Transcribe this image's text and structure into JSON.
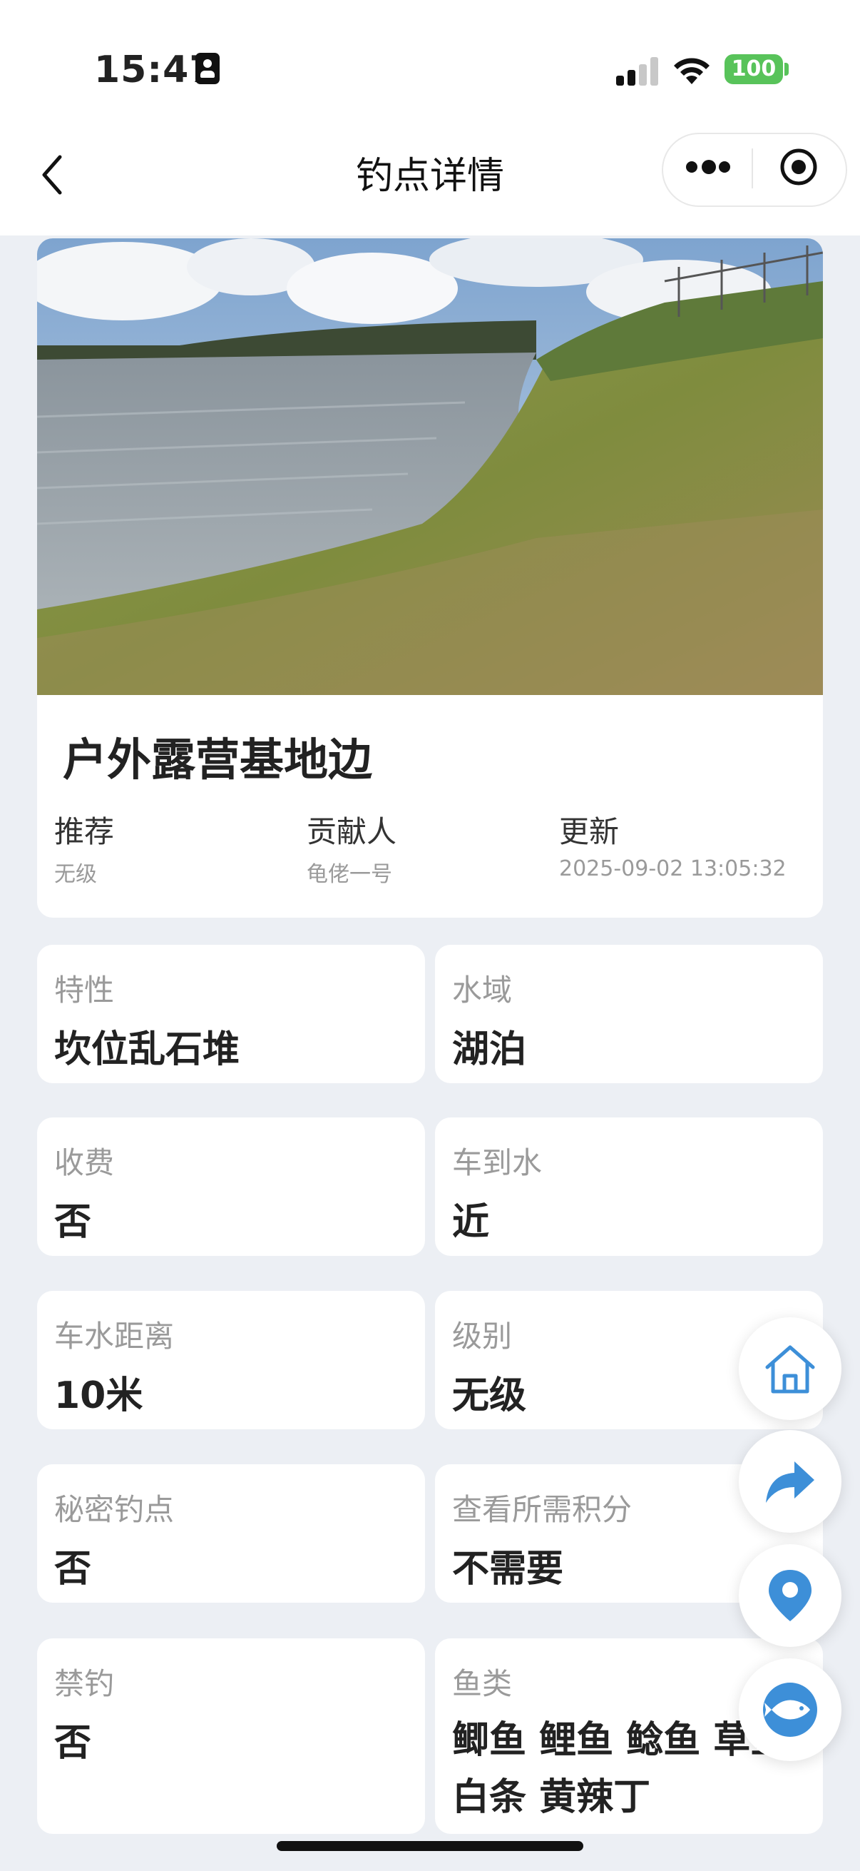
{
  "status_bar": {
    "time": "15:47",
    "battery": "100"
  },
  "nav": {
    "title": "钓点详情"
  },
  "spot": {
    "name": "户外露营基地边",
    "meta": [
      {
        "label": "推荐",
        "value": "无级"
      },
      {
        "label": "贡献人",
        "value": "龟佬一号"
      },
      {
        "label": "更新",
        "value": "2025-09-02 13:05:32"
      }
    ]
  },
  "info": [
    {
      "label": "特性",
      "value": "坎位乱石堆"
    },
    {
      "label": "水域",
      "value": "湖泊"
    },
    {
      "label": "收费",
      "value": "否"
    },
    {
      "label": "车到水",
      "value": "近"
    },
    {
      "label": "车水距离",
      "value": "10米"
    },
    {
      "label": "级别",
      "value": "无级"
    },
    {
      "label": "秘密钓点",
      "value": "否"
    },
    {
      "label": "查看所需积分",
      "value": "不需要"
    },
    {
      "label": "禁钓",
      "value": "否"
    },
    {
      "label": "鱼类",
      "lines": [
        "鲫鱼 鲤鱼 鲶鱼 草鱼",
        "白条 黄辣丁"
      ]
    }
  ],
  "fabs": [
    "home-icon",
    "share-icon",
    "location-pin-icon",
    "fish-icon"
  ],
  "colors": {
    "accent": "#3d8fd8",
    "battery": "#58c35a",
    "page_bg": "#eceff4"
  }
}
